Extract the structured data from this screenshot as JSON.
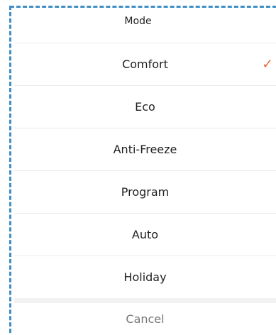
{
  "sheet": {
    "title": "Mode",
    "options": [
      {
        "label": "Comfort",
        "selected": true
      },
      {
        "label": "Eco",
        "selected": false
      },
      {
        "label": "Anti-Freeze",
        "selected": false
      },
      {
        "label": "Program",
        "selected": false
      },
      {
        "label": "Auto",
        "selected": false
      },
      {
        "label": "Holiday",
        "selected": false
      }
    ],
    "check_glyph": "✓",
    "cancel_label": "Cancel"
  },
  "colors": {
    "accent": "#ec6a3a",
    "frame": "#3f8fc4",
    "separator": "#ececec",
    "gap": "#f2f2f2"
  },
  "icons": {
    "selected": "checkmark-icon"
  }
}
